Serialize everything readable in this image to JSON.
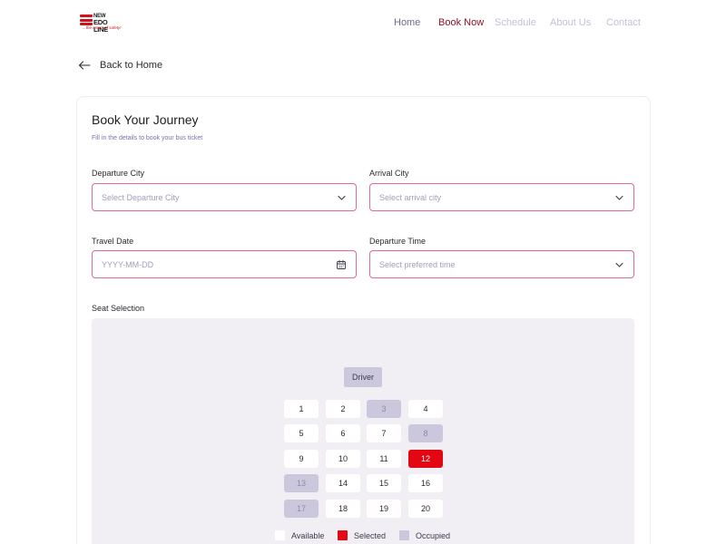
{
  "logo": {
    "line1": "NEW",
    "line2": "EDO LINE",
    "tagline": "...the return of safety!"
  },
  "nav": {
    "home": "Home",
    "book": "Book Now",
    "schedule": "Schedule",
    "about": "About Us",
    "contact": "Contact"
  },
  "back": {
    "label": "Back to Home"
  },
  "form": {
    "title": "Book Your Journey",
    "subtitle": "Fill in the details to book your bus ticket",
    "departure_city": {
      "label": "Departure City",
      "placeholder": "Select Departure City"
    },
    "arrival_city": {
      "label": "Arrival City",
      "placeholder": "Select arrival city"
    },
    "travel_date": {
      "label": "Travel Date",
      "placeholder": "YYYY-MM-DD"
    },
    "departure_time": {
      "label": "Departure Time",
      "placeholder": "Select preferred time"
    }
  },
  "seat_selection": {
    "label": "Seat Selection",
    "driver": "Driver",
    "seats": [
      {
        "n": "1",
        "status": "available"
      },
      {
        "n": "2",
        "status": "available"
      },
      {
        "n": "3",
        "status": "occupied"
      },
      {
        "n": "4",
        "status": "available"
      },
      {
        "n": "5",
        "status": "available"
      },
      {
        "n": "6",
        "status": "available"
      },
      {
        "n": "7",
        "status": "available"
      },
      {
        "n": "8",
        "status": "occupied"
      },
      {
        "n": "9",
        "status": "available"
      },
      {
        "n": "10",
        "status": "available"
      },
      {
        "n": "11",
        "status": "available"
      },
      {
        "n": "12",
        "status": "selected"
      },
      {
        "n": "13",
        "status": "occupied"
      },
      {
        "n": "14",
        "status": "available"
      },
      {
        "n": "15",
        "status": "available"
      },
      {
        "n": "16",
        "status": "available"
      },
      {
        "n": "17",
        "status": "occupied"
      },
      {
        "n": "18",
        "status": "available"
      },
      {
        "n": "19",
        "status": "available"
      },
      {
        "n": "20",
        "status": "available"
      }
    ],
    "legend": {
      "available": "Available",
      "selected": "Selected",
      "occupied": "Occupied"
    }
  },
  "colors": {
    "brand_red": "#e30613",
    "nav_active": "#8b1326",
    "field_border": "#e8678a",
    "occupied": "#cbc8dd",
    "panel_bg": "#f1eff3"
  }
}
